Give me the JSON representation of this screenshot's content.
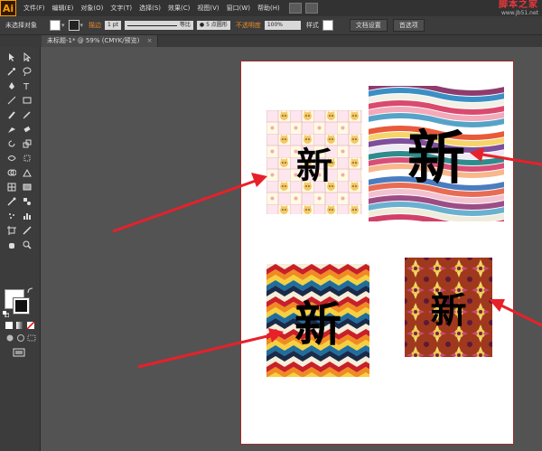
{
  "app": {
    "logo": "Ai"
  },
  "menu": [
    "文件(F)",
    "编辑(E)",
    "对象(O)",
    "文字(T)",
    "选择(S)",
    "效果(C)",
    "视图(V)",
    "窗口(W)",
    "帮助(H)"
  ],
  "watermark": {
    "title": "脚本之家",
    "url": "www.Jb51.net"
  },
  "control_bar": {
    "selection_label": "未选择对象",
    "stroke_label": "描边",
    "stroke_value": "1 pt",
    "profile_label": "等比",
    "brush_value": "5 点圆形",
    "opacity_label": "不透明度",
    "opacity_value": "100%",
    "style_label": "样式",
    "doc_setup_button": "文档设置",
    "prefs_button": "首选项"
  },
  "document_tab": {
    "title": "未标题-1* @ 59% (CMYK/预览)",
    "close": "×"
  },
  "artwork": {
    "glyph": "新",
    "patterns": [
      "cat-grid-pattern",
      "wave-stripes-pattern",
      "zigzag-chevron-pattern",
      "floral-ornament-pattern"
    ]
  },
  "colors": {
    "workspace_bg": "#535353",
    "artboard_border": "#9c2b2b",
    "annotation_arrow": "#e8202a",
    "app_orange": "#ff9a00"
  }
}
